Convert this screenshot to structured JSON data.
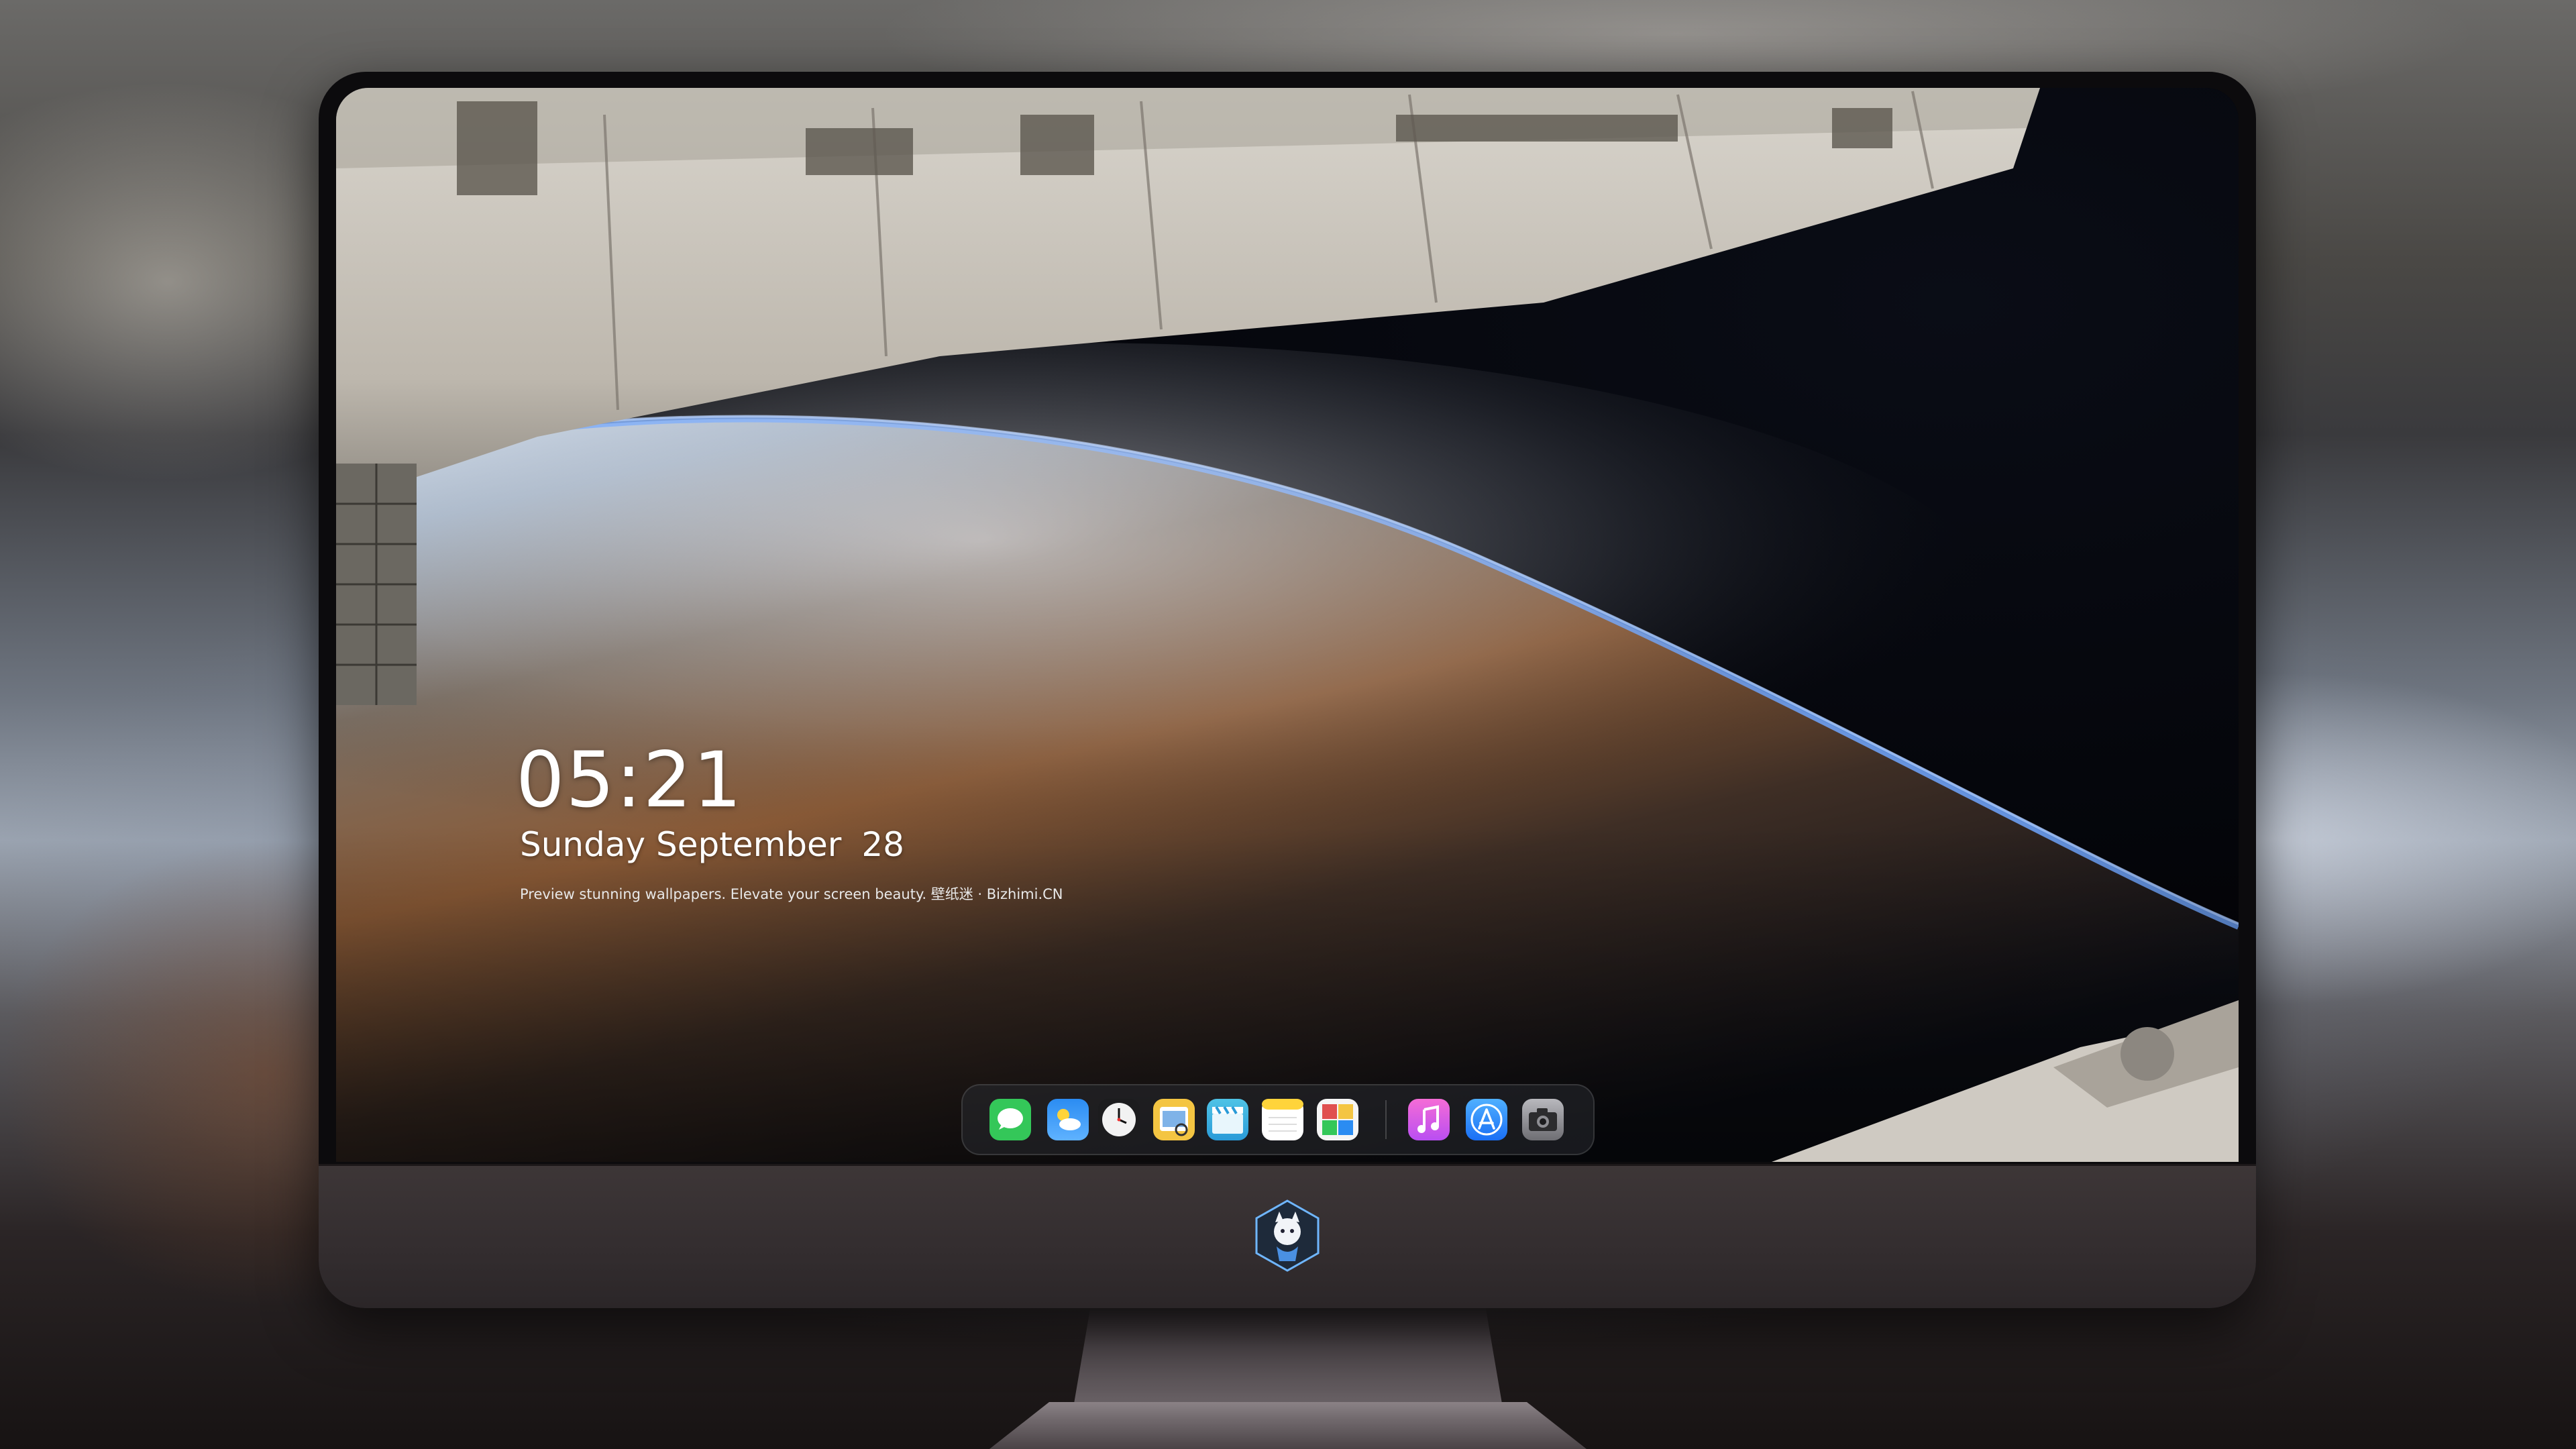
{
  "lock_screen": {
    "time": "05:21",
    "date_text": "Sunday September",
    "day_number": "28",
    "tagline": "Preview stunning wallpapers. Elevate your screen beauty. 壁纸迷 · Bizhimi.CN"
  },
  "dock": {
    "apps": [
      {
        "name": "messages-icon",
        "color": "#34c759"
      },
      {
        "name": "weather-icon",
        "color": "#2b8cf2"
      },
      {
        "name": "clock-icon",
        "color": "#f2f2f2"
      },
      {
        "name": "preview-icon",
        "color": "#f4c542"
      },
      {
        "name": "video-editor-icon",
        "color": "#4fc3e6"
      },
      {
        "name": "notes-icon",
        "color": "#ffd43b"
      },
      {
        "name": "photos-app-icon",
        "color": "#e04f4f"
      },
      {
        "name": "music-icon",
        "color": "#e24cdb"
      },
      {
        "name": "app-store-icon",
        "color": "#1a8cf5"
      },
      {
        "name": "camera-icon",
        "color": "#8e8e93"
      }
    ]
  },
  "monitor": {
    "logo": "mascot-logo-icon"
  }
}
